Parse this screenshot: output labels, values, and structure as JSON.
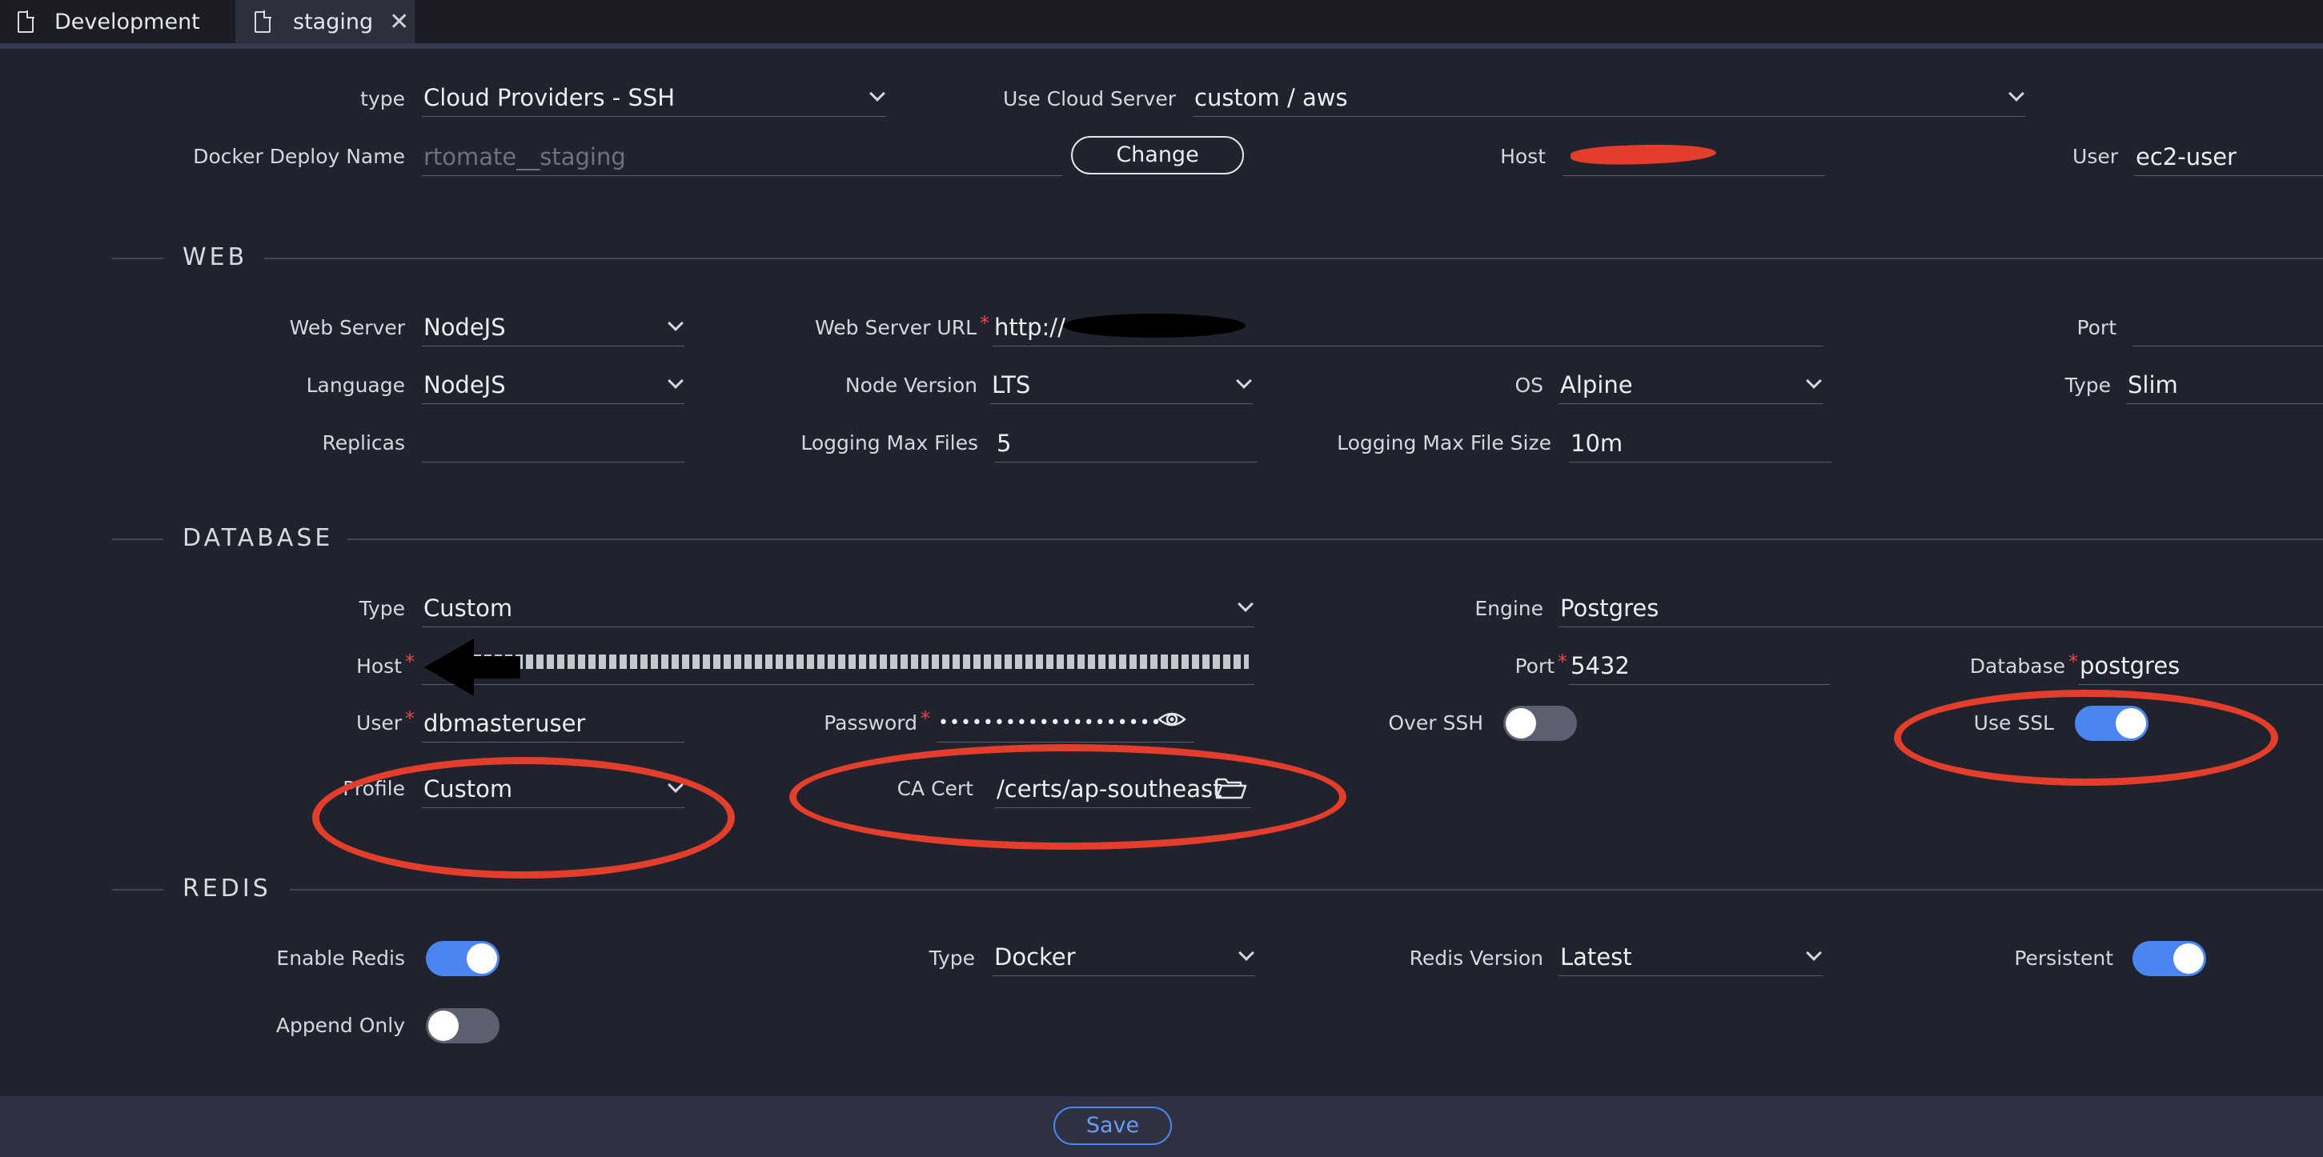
{
  "tabs": [
    {
      "label": "Development",
      "active": false
    },
    {
      "label": "staging",
      "active": true
    }
  ],
  "deploy": {
    "type_label": "type",
    "type_value": "Cloud Providers - SSH",
    "cloud_server_label": "Use Cloud Server",
    "cloud_server_value": "custom / aws",
    "deploy_name_label": "Docker Deploy Name",
    "deploy_name_placeholder": "rtomate__staging",
    "change_button": "Change",
    "host_label": "Host",
    "host_value": "",
    "user_label": "User",
    "user_value": "ec2-user"
  },
  "web": {
    "section_title": "WEB",
    "web_server_label": "Web Server",
    "web_server_value": "NodeJS",
    "url_label": "Web Server URL",
    "url_value": "http://",
    "port_label": "Port",
    "port_value": "",
    "language_label": "Language",
    "language_value": "NodeJS",
    "node_version_label": "Node Version",
    "node_version_value": "LTS",
    "os_label": "OS",
    "os_value": "Alpine",
    "type_label": "Type",
    "type_value": "Slim",
    "replicas_label": "Replicas",
    "replicas_value": "",
    "log_files_label": "Logging Max Files",
    "log_files_value": "5",
    "log_size_label": "Logging Max File Size",
    "log_size_value": "10m"
  },
  "database": {
    "section_title": "DATABASE",
    "type_label": "Type",
    "type_value": "Custom",
    "engine_label": "Engine",
    "engine_value": "Postgres",
    "host_label": "Host",
    "host_value": "",
    "port_label": "Port",
    "port_value": "5432",
    "database_label": "Database",
    "database_value": "postgres",
    "user_label": "User",
    "user_value": "dbmasteruser",
    "password_label": "Password",
    "password_value": "••••••••••••••••••••",
    "over_ssh_label": "Over SSH",
    "over_ssh_on": false,
    "use_ssl_label": "Use SSL",
    "use_ssl_on": true,
    "profile_label": "Profile",
    "profile_value": "Custom",
    "ca_cert_label": "CA Cert",
    "ca_cert_value": "/certs/ap-southeast"
  },
  "redis": {
    "section_title": "REDIS",
    "enable_label": "Enable Redis",
    "enable_on": true,
    "type_label": "Type",
    "type_value": "Docker",
    "version_label": "Redis Version",
    "version_value": "Latest",
    "persistent_label": "Persistent",
    "persistent_on": true,
    "append_only_label": "Append Only",
    "append_only_on": false
  },
  "footer": {
    "save_label": "Save"
  },
  "colors": {
    "accent": "#4b86f0",
    "background": "#20222e",
    "annotation": "#e33d2b",
    "required": "#e5484d"
  }
}
